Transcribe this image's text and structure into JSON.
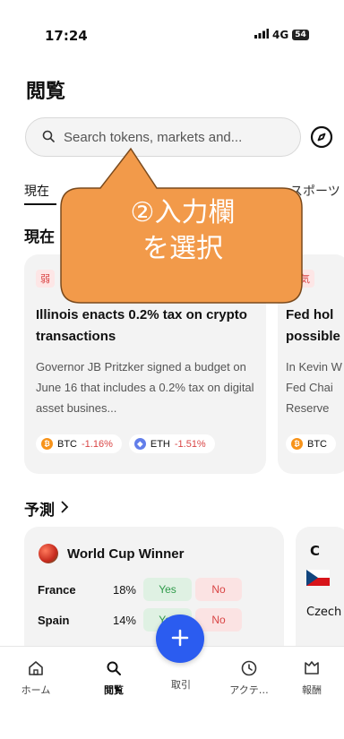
{
  "status_bar": {
    "time": "17:24",
    "signal": "4G",
    "battery": "54"
  },
  "page": {
    "title": "閲覧"
  },
  "search": {
    "placeholder": "Search tokens, markets and..."
  },
  "tabs": {
    "current": "現在",
    "sports": "スポーツ"
  },
  "sections": {
    "now": "現在",
    "predictions": "予測"
  },
  "news": [
    {
      "badge": "弱",
      "headline": "Illinois enacts 0.2% tax on crypto transactions",
      "body": "Governor JB Pritzker signed a budget on June 16 that includes a 0.2% tax on digital asset busines...",
      "chips": [
        {
          "symbol": "BTC",
          "change": "-1.16%"
        },
        {
          "symbol": "ETH",
          "change": "-1.51%"
        }
      ]
    },
    {
      "badge": "弱気",
      "headline_line1": "Fed hol",
      "headline_line2": "possible",
      "body_line1": "In Kevin W",
      "body_line2": "Fed Chai",
      "body_line3": "Reserve",
      "chip_symbol": "BTC"
    }
  ],
  "markets": [
    {
      "title": "World Cup Winner",
      "rows": [
        {
          "name": "France",
          "pct": "18%",
          "yes": "Yes",
          "no": "No"
        },
        {
          "name": "Spain",
          "pct": "14%",
          "yes": "Yes",
          "no": "No"
        }
      ]
    },
    {
      "title_partial": "C",
      "country": "Czech"
    }
  ],
  "nav": {
    "home": "ホーム",
    "browse": "閲覧",
    "trade": "取引",
    "activity": "アクテ…",
    "rewards": "報酬"
  },
  "annotation": {
    "line1": "②入力欄",
    "line2": "を選択"
  },
  "colors": {
    "accent": "#2b5cf0",
    "callout": "#f29a4a",
    "negative": "#d94545",
    "positive": "#2f9a4a"
  }
}
